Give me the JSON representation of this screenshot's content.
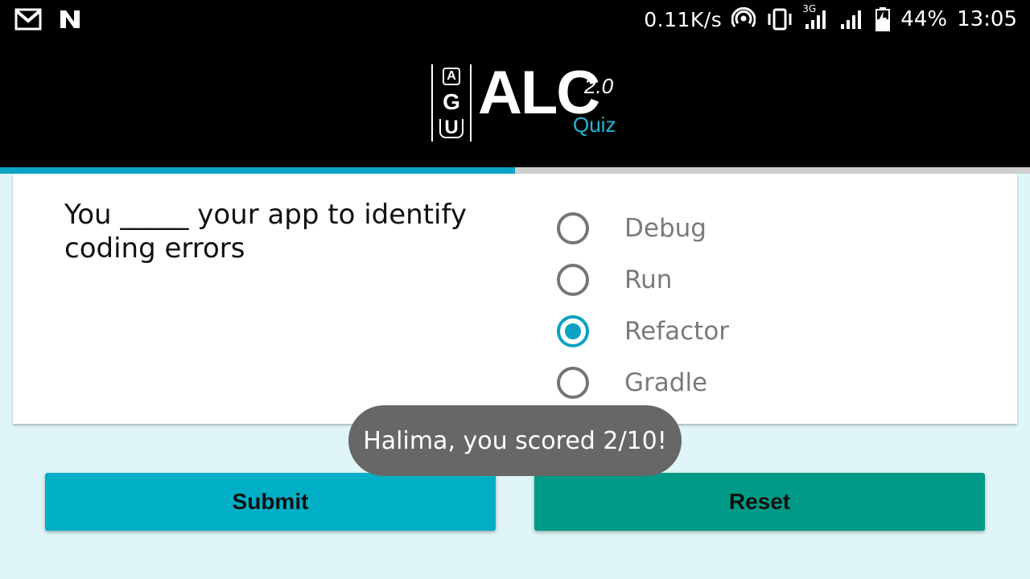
{
  "status_bar": {
    "left_icons": [
      "gmail-icon",
      "nfc-icon"
    ],
    "net_speed": "0.11K/s",
    "network_type": "3G",
    "battery_percent": "44%",
    "time": "13:05"
  },
  "header": {
    "logo_text": "ALC",
    "logo_version": "2.0",
    "logo_subtitle": "Quiz",
    "logo_side_letters": [
      "A",
      "G",
      "U"
    ]
  },
  "progress": {
    "value": 0.5,
    "color": "#0aa3c2"
  },
  "question": {
    "text": "You _____ your app to identify coding errors",
    "options": [
      {
        "label": "Debug",
        "selected": false
      },
      {
        "label": "Run",
        "selected": false
      },
      {
        "label": "Refactor",
        "selected": true
      },
      {
        "label": "Gradle",
        "selected": false
      }
    ]
  },
  "buttons": {
    "submit": "Submit",
    "reset": "Reset"
  },
  "toast": {
    "message": "Halima, you scored 2/10!"
  },
  "colors": {
    "accent": "#0aa3c2",
    "submit_bg": "#00afc6",
    "reset_bg": "#009a86",
    "page_bg": "#dff5f7"
  }
}
